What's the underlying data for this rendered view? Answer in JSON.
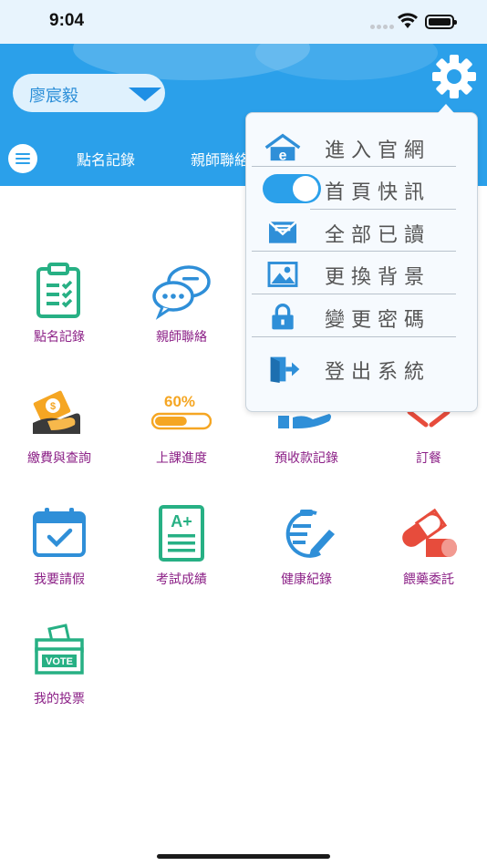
{
  "status_bar": {
    "time": "9:04"
  },
  "header": {
    "student_name": "廖宸毅"
  },
  "tabs": [
    {
      "label": "點名記錄"
    },
    {
      "label": "親師聯絡"
    }
  ],
  "grid": [
    {
      "label": "點名記錄",
      "icon": "clipboard-check-icon"
    },
    {
      "label": "親師聯絡",
      "icon": "chat-bubbles-icon"
    },
    {
      "label": "繳費與查詢",
      "icon": "money-hand-icon"
    },
    {
      "label": "上課進度",
      "icon": "progress-bar-icon",
      "icon_text": "60%",
      "progress": 0.6
    },
    {
      "label": "預收款記錄",
      "icon": "hand-coins-icon"
    },
    {
      "label": "訂餐",
      "icon": "utensils-icon"
    },
    {
      "label": "我要請假",
      "icon": "calendar-check-icon"
    },
    {
      "label": "考試成績",
      "icon": "grade-sheet-icon",
      "icon_text": "A+"
    },
    {
      "label": "健康紀錄",
      "icon": "health-list-icon"
    },
    {
      "label": "餵藥委託",
      "icon": "pill-icon"
    },
    {
      "label": "我的投票",
      "icon": "ballot-box-icon",
      "icon_text": "VOTE"
    }
  ],
  "settings_menu": {
    "items": [
      {
        "label": "進入官網",
        "icon": "home-web-icon"
      },
      {
        "label": "首頁快訊",
        "icon": "toggle-switch",
        "toggle_on": true
      },
      {
        "label": "全部已讀",
        "icon": "mail-icon"
      },
      {
        "label": "更換背景",
        "icon": "image-icon"
      },
      {
        "label": "變更密碼",
        "icon": "lock-icon"
      },
      {
        "label": "登出系統",
        "icon": "exit-door-icon"
      }
    ]
  },
  "colors": {
    "accent": "#2ba0ea",
    "label": "#8b1f86",
    "green": "#27b084",
    "orange": "#f5a623",
    "blue_icon": "#2f8fd8",
    "red_icon": "#e74c3c"
  }
}
